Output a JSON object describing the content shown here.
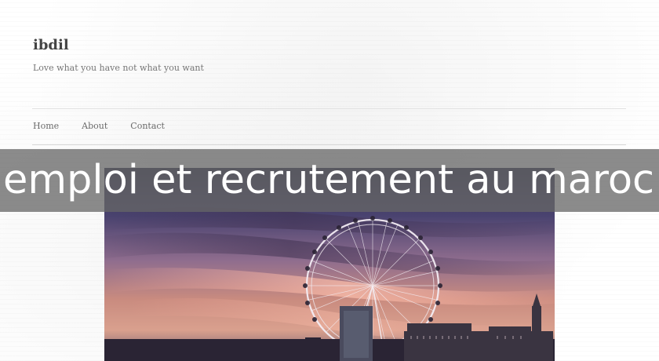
{
  "site": {
    "title": "ibdil",
    "tagline": "Love what you have not what you want"
  },
  "nav": {
    "items": [
      "Home",
      "About",
      "Contact"
    ]
  },
  "banner": {
    "text": "emploi et recrutement au maroc"
  },
  "hero": {
    "alt": "London Eye at sunset"
  }
}
